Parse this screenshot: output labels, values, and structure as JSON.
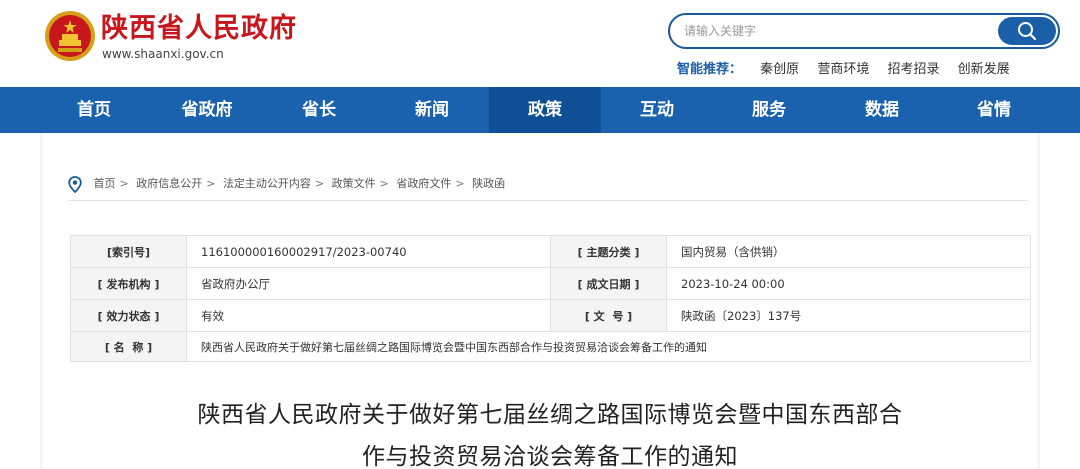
{
  "header": {
    "site_name": "陕西省人民政府",
    "site_url": "www.shaanxi.gov.cn",
    "search_placeholder": "请输入关键字",
    "recommend_label": "智能推荐：",
    "recommend_links": [
      "秦创原",
      "营商环境",
      "招考招录",
      "创新发展"
    ]
  },
  "nav": {
    "items": [
      "首页",
      "省政府",
      "省长",
      "新闻",
      "政策",
      "互动",
      "服务",
      "数据",
      "省情"
    ],
    "active_index": 4
  },
  "breadcrumb": [
    "首页",
    "政府信息公开",
    "法定主动公开内容",
    "政策文件",
    "省政府文件",
    "陕政函"
  ],
  "info": {
    "index_label": "[索引号]",
    "index_value": "116100000160002917/2023-00740",
    "topic_label": "[ 主题分类 ]",
    "topic_value": "国内贸易（含供销）",
    "issuer_label": "[ 发布机构 ]",
    "issuer_value": "省政府办公厅",
    "date_label": "[ 成文日期 ]",
    "date_value": "2023-10-24 00:00",
    "status_label": "[ 效力状态 ]",
    "status_value": "有效",
    "docno_label": "[ 文  号 ]",
    "docno_value": "陕政函〔2023〕137号",
    "name_label": "[ 名  称 ]",
    "name_value": "陕西省人民政府关于做好第七届丝绸之路国际博览会暨中国东西部合作与投资贸易洽谈会筹备工作的通知"
  },
  "article": {
    "title_line1": "陕西省人民政府关于做好第七届丝绸之路国际博览会暨中国东西部合",
    "title_line2": "作与投资贸易洽谈会筹备工作的通知"
  },
  "colors": {
    "brand_red": "#c8161d",
    "nav_blue": "#1a62ad",
    "nav_active": "#0e4f96"
  }
}
